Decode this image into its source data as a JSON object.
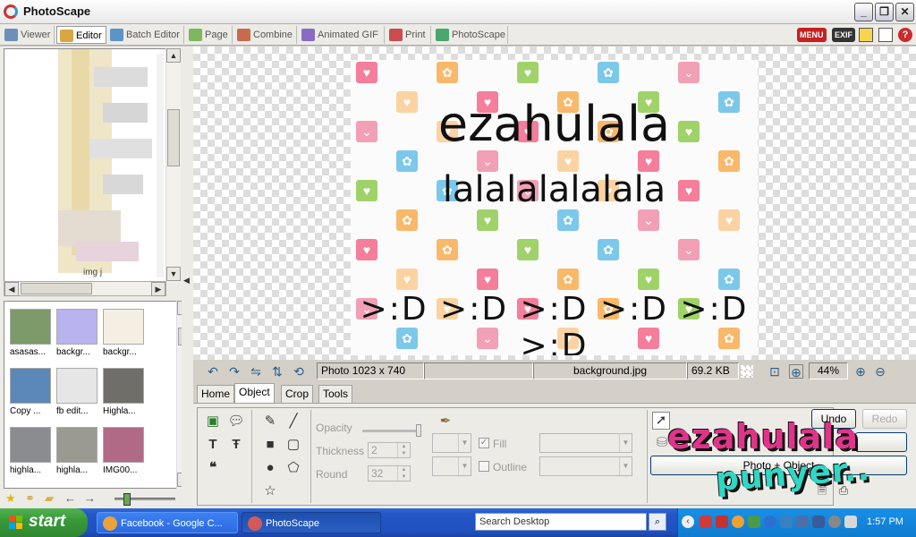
{
  "window": {
    "title": "PhotoScape"
  },
  "tabs": [
    {
      "label": "Viewer",
      "color": "#6e8fb8"
    },
    {
      "label": "Editor",
      "color": "#d9a641",
      "active": true
    },
    {
      "label": "Batch Editor",
      "color": "#5b94c7"
    },
    {
      "label": "Page",
      "color": "#7db85c"
    },
    {
      "label": "Combine",
      "color": "#c86b4b"
    },
    {
      "label": "Animated GIF",
      "color": "#8b6bc2"
    },
    {
      "label": "Print",
      "color": "#c94d4d"
    },
    {
      "label": "PhotoScape",
      "color": "#4aa66d"
    }
  ],
  "toolbar_right": {
    "menu_label": "MENU",
    "exif_label": "EXIF"
  },
  "tree": {
    "partial_label": "img j"
  },
  "thumbnails": [
    {
      "label": "asasas...",
      "color": "#7d9a6a"
    },
    {
      "label": "backgr...",
      "color": "#b9b3ef"
    },
    {
      "label": "backgr...",
      "color": "#f4efe2"
    },
    {
      "label": "Copy ...",
      "color": "#5b88b8"
    },
    {
      "label": "fb edit...",
      "color": "#e6e6e6"
    },
    {
      "label": "Highla...",
      "color": "#6f6e69"
    },
    {
      "label": "highla...",
      "color": "#8a8c90"
    },
    {
      "label": "highla...",
      "color": "#9a9a92"
    },
    {
      "label": "IMG00...",
      "color": "#b06a86"
    }
  ],
  "image": {
    "line1": "ezahulala",
    "line2": "lalalalalalala",
    "line3": ">:D >:D >:D >:D >:D >:D"
  },
  "status": {
    "dimensions": "Photo 1023 x 740",
    "filename": "background.jpg",
    "filesize": "69.2 KB",
    "zoom": "44%"
  },
  "editor_tabs": [
    {
      "label": "Home"
    },
    {
      "label": "Object",
      "active": true
    },
    {
      "label": "Crop"
    },
    {
      "label": "Tools"
    }
  ],
  "object_panel": {
    "opacity_label": "Opacity",
    "thickness_label": "Thickness",
    "thickness_value": "2",
    "round_label": "Round",
    "round_value": "32",
    "fill_label": "Fill",
    "outline_label": "Outline"
  },
  "buttons": {
    "undo": "Undo",
    "redo": "Redo",
    "photo_object": "Photo + Object"
  },
  "sticker": {
    "line1": "ezahulala",
    "line2": "punyer..",
    "color1": "#e0348a",
    "color2": "#2fd7c4"
  },
  "taskbar": {
    "start": "start",
    "items": [
      {
        "label": "Facebook - Google C...",
        "color": "#e8a33a"
      },
      {
        "label": "PhotoScape",
        "color": "#d45a5a",
        "active": true
      }
    ],
    "search_placeholder": "Search Desktop",
    "clock": "1:57 PM"
  }
}
